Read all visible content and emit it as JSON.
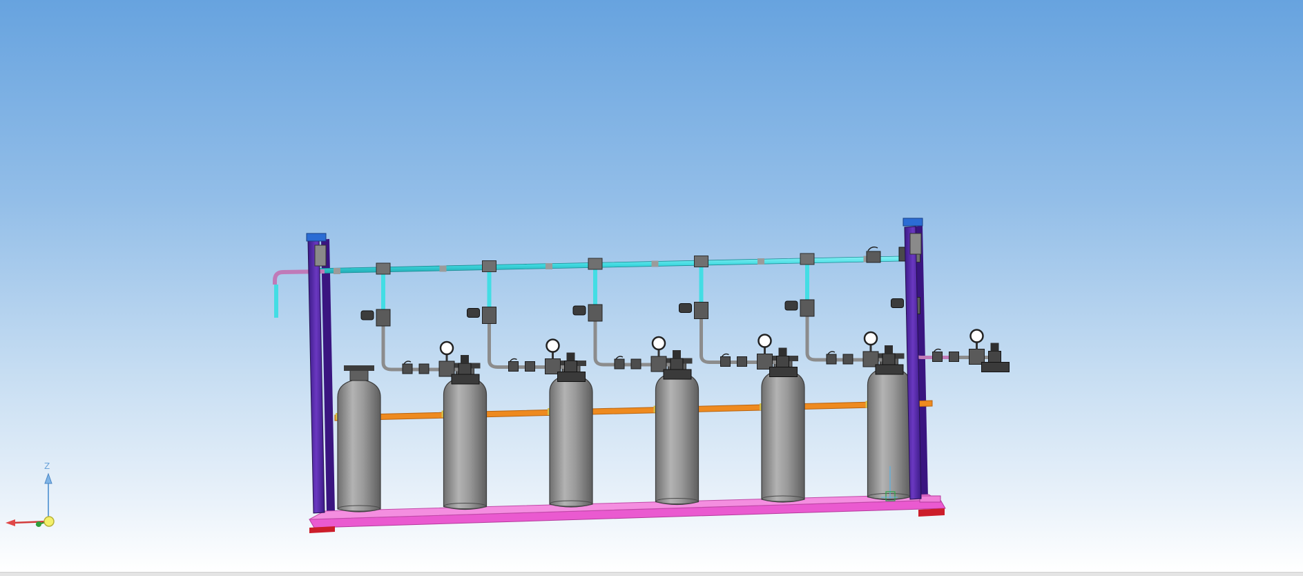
{
  "viewport": {
    "background_top": "#67a3df",
    "background_bottom": "#ffffff"
  },
  "triad": {
    "z_label": "Z"
  },
  "colors": {
    "manifold_pipe": "#43dde4",
    "branch_pipe": "#43dde4",
    "drop_pipe": "#8c8c8c",
    "purple_pipe": "#c07ab8",
    "frame_post": "#5a2aa6",
    "frame_cap": "#2b6cd4",
    "base_rail": "#ea5ad0",
    "base_foot": "#cc1d2a",
    "restraint_bar": "#ee8a1f",
    "cylinder": "#9a9a9a",
    "valve": "#505050"
  },
  "assembly": {
    "cylinder_count": 6,
    "regulator_count": 6,
    "gauge_count": 6
  }
}
